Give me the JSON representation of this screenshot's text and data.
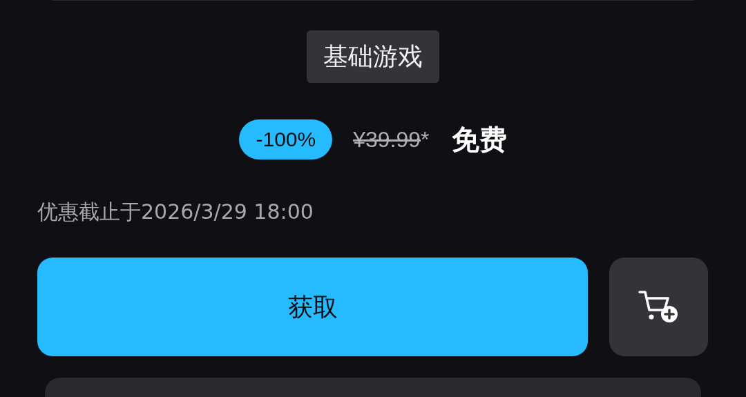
{
  "edition_badge": "基础游戏",
  "price": {
    "discount": "-100%",
    "original_price": "¥39.99",
    "original_price_struck": true,
    "footnote_mark": "*",
    "current_price": "免费"
  },
  "offer_end": "优惠截止于2026/3/29 18:00",
  "buttons": {
    "get": "获取"
  }
}
